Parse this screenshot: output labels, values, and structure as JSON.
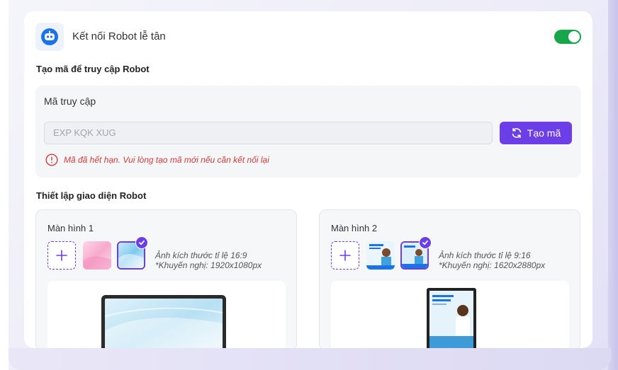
{
  "robot": {
    "title": "Kết nối Robot lễ tân",
    "enabled": true
  },
  "access": {
    "section_title": "Tạo mã để truy cập Robot",
    "label": "Mã truy cập",
    "code_placeholder": "EXP KQK XUG",
    "generate_label": "Tạo mã",
    "error": "Mã đã hết hạn. Vui lòng tạo mã mới nếu cần kết nối lại"
  },
  "ui_settings": {
    "section_title": "Thiết lập giao diện Robot",
    "screens": [
      {
        "title": "Màn hình 1",
        "hint_ratio": "Ảnh kích thước tỉ lệ 16:9",
        "hint_size": "*Khuyến nghị: 1920x1080px"
      },
      {
        "title": "Màn hình 2",
        "hint_ratio": "Ảnh kích thước tỉ lệ 9:16",
        "hint_size": "*Khuyến nghị: 1620x2880px"
      }
    ]
  },
  "colors": {
    "accent": "#6c3ee8",
    "toggle_on": "#19a54a",
    "error": "#d23a3a",
    "robot_icon": "#1a73e8"
  },
  "icons": {
    "robot": "robot-icon",
    "refresh": "refresh-icon",
    "error": "alert-circle-icon",
    "add": "plus-icon",
    "check": "check-icon"
  }
}
